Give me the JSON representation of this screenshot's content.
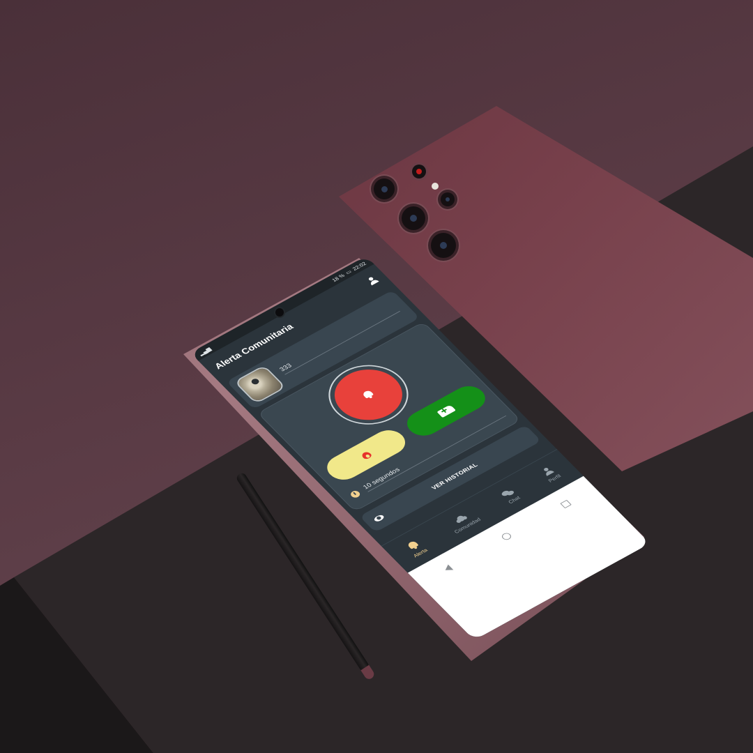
{
  "status_bar": {
    "time": "22:02",
    "battery": "18 %"
  },
  "app_bar": {
    "title": "Alerta Comunitaria"
  },
  "user_card": {
    "name": "333"
  },
  "alert": {
    "timer_text": "10 segundos"
  },
  "history": {
    "label": "VER HISTORIAL"
  },
  "bottom_nav": {
    "items": [
      {
        "label": "Alerta",
        "icon": "bell-icon",
        "active": true
      },
      {
        "label": "Comunidad",
        "icon": "users-icon",
        "active": false
      },
      {
        "label": "Chat",
        "icon": "chat-icon",
        "active": false
      },
      {
        "label": "Perfil",
        "icon": "user-icon",
        "active": false
      }
    ]
  },
  "colors": {
    "background": "#2b343b",
    "card": "#394650",
    "panic_red": "#e8413b",
    "fire_yellow": "#f1e88a",
    "ambulance_green": "#149018",
    "active_nav": "#f2d08e"
  }
}
